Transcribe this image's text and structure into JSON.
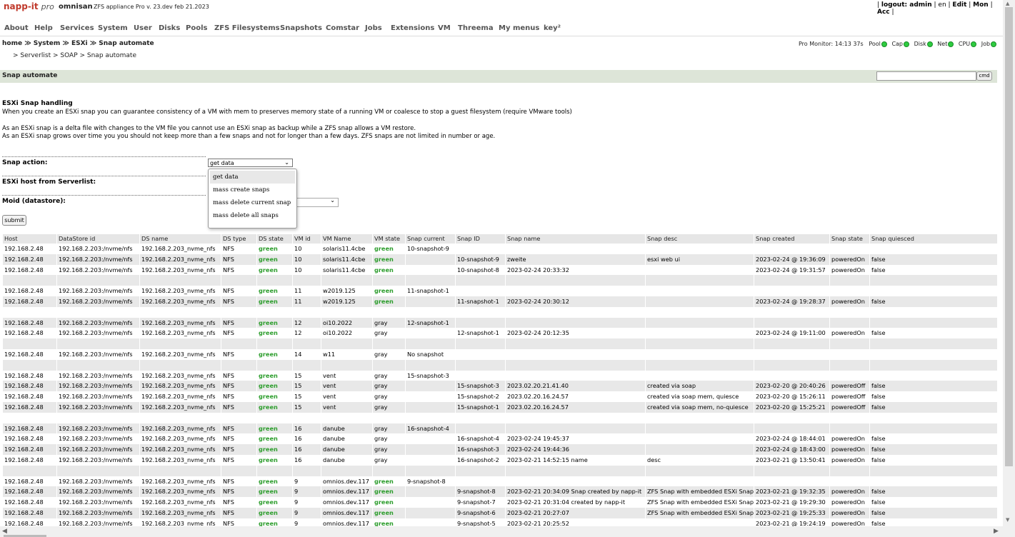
{
  "header": {
    "logo": "napp-it",
    "logo_pro": "pro",
    "hostname": "omnisan",
    "version": "ZFS appliance Pro v. 23.dev feb 21.2023",
    "logout": "logout: admin",
    "lang": "en",
    "edit": "Edit",
    "mon": "Mon",
    "acc": "Acc"
  },
  "nav": {
    "items": [
      "About",
      "Help",
      "Services",
      "System",
      "User",
      "Disks",
      "Pools",
      "ZFS Filesystems",
      "Snapshots",
      "Comstar",
      "Jobs",
      "Extensions",
      "VM",
      "Threema",
      "My menus",
      "key²"
    ]
  },
  "breadcrumb": {
    "line1": "home ≫ System ≫ ESXi ≫ Snap automate",
    "line2": "> Serverlist  > SOAP  > Snap automate"
  },
  "monitor": {
    "label": "Pro Monitor: 14:13 37s",
    "items": [
      "Pool",
      "Cap",
      "Disk",
      "Net",
      "CPU",
      "Job"
    ]
  },
  "section": {
    "title": "Snap automate",
    "cmd_label": "cmd"
  },
  "info": {
    "heading": "ESXi Snap handling",
    "p1": "When you create an ESXi snap you can guarantee consistency of a VM with mem to preserves memory state of a running VM or coalesce to stop a guest filesystem (require VMware tools)",
    "p2": "As an ESXi snap is a delta file with changes to the VM file you cannot use an ESXi snap as backup while a ZFS snap allows a VM restore.",
    "p3": "As an ESXi snap grows over time you you should not keep more than a few snaps and not for longer than a few days. ZFS snaps are not limited in number or age."
  },
  "form": {
    "snap_action_label": "Snap action:",
    "snap_action_value": "get data",
    "esxi_host_label": "ESXi host from Serverlist:",
    "moid_label": "Moid (datastore):",
    "submit_label": "submit",
    "dropdown_options": [
      "get data",
      "mass create snaps",
      "mass delete current snap",
      "mass delete all snaps"
    ]
  },
  "table": {
    "columns": [
      "Host",
      "DataStore id",
      "DS name",
      "DS type",
      "DS state",
      "VM id",
      "VM Name",
      "VM state",
      "Snap current",
      "Snap ID",
      "Snap name",
      "Snap desc",
      "Snap created",
      "Snap state",
      "Snap quiesced"
    ],
    "rows": [
      [
        "192.168.2.48",
        "192.168.2.203:/nvme/nfs",
        "192.168.2.203_nvme_nfs",
        "NFS",
        "green",
        "10",
        "solaris11.4cbe",
        "green",
        "10-snapshot-9",
        "",
        "",
        "",
        "",
        "",
        ""
      ],
      [
        "192.168.2.48",
        "192.168.2.203:/nvme/nfs",
        "192.168.2.203_nvme_nfs",
        "NFS",
        "green",
        "10",
        "solaris11.4cbe",
        "green",
        "",
        "10-snapshot-9",
        "zweite",
        "esxi web ui",
        "2023-02-24 @ 19:36:09",
        "poweredOn",
        "false"
      ],
      [
        "192.168.2.48",
        "192.168.2.203:/nvme/nfs",
        "192.168.2.203_nvme_nfs",
        "NFS",
        "green",
        "10",
        "solaris11.4cbe",
        "green",
        "",
        "10-snapshot-8",
        "2023-02-24 20:33:32",
        "",
        "2023-02-24 @ 19:31:57",
        "poweredOn",
        "false"
      ],
      [
        "",
        "",
        "",
        "",
        "",
        "",
        "",
        "",
        "",
        "",
        "",
        "",
        "",
        "",
        ""
      ],
      [
        "192.168.2.48",
        "192.168.2.203:/nvme/nfs",
        "192.168.2.203_nvme_nfs",
        "NFS",
        "green",
        "11",
        "w2019.125",
        "green",
        "11-snapshot-1",
        "",
        "",
        "",
        "",
        "",
        ""
      ],
      [
        "192.168.2.48",
        "192.168.2.203:/nvme/nfs",
        "192.168.2.203_nvme_nfs",
        "NFS",
        "green",
        "11",
        "w2019.125",
        "green",
        "",
        "11-snapshot-1",
        "2023-02-24 20:30:12",
        "",
        "2023-02-24 @ 19:28:37",
        "poweredOn",
        "false"
      ],
      [
        "",
        "",
        "",
        "",
        "",
        "",
        "",
        "",
        "",
        "",
        "",
        "",
        "",
        "",
        ""
      ],
      [
        "192.168.2.48",
        "192.168.2.203:/nvme/nfs",
        "192.168.2.203_nvme_nfs",
        "NFS",
        "green",
        "12",
        "oi10.2022",
        "gray",
        "12-snapshot-1",
        "",
        "",
        "",
        "",
        "",
        ""
      ],
      [
        "192.168.2.48",
        "192.168.2.203:/nvme/nfs",
        "192.168.2.203_nvme_nfs",
        "NFS",
        "green",
        "12",
        "oi10.2022",
        "gray",
        "",
        "12-snapshot-1",
        "2023-02-24 20:12:35",
        "",
        "2023-02-24 @ 19:11:00",
        "poweredOn",
        "false"
      ],
      [
        "",
        "",
        "",
        "",
        "",
        "",
        "",
        "",
        "",
        "",
        "",
        "",
        "",
        "",
        ""
      ],
      [
        "192.168.2.48",
        "192.168.2.203:/nvme/nfs",
        "192.168.2.203_nvme_nfs",
        "NFS",
        "green",
        "14",
        "w11",
        "gray",
        "No snapshot",
        "",
        "",
        "",
        "",
        "",
        ""
      ],
      [
        "",
        "",
        "",
        "",
        "",
        "",
        "",
        "",
        "",
        "",
        "",
        "",
        "",
        "",
        ""
      ],
      [
        "192.168.2.48",
        "192.168.2.203:/nvme/nfs",
        "192.168.2.203_nvme_nfs",
        "NFS",
        "green",
        "15",
        "vent",
        "gray",
        "15-snapshot-3",
        "",
        "",
        "",
        "",
        "",
        ""
      ],
      [
        "192.168.2.48",
        "192.168.2.203:/nvme/nfs",
        "192.168.2.203_nvme_nfs",
        "NFS",
        "green",
        "15",
        "vent",
        "gray",
        "",
        "15-snapshot-3",
        "2023.02.20.21.41.40",
        "created via soap",
        "2023-02-20 @ 20:40:26",
        "poweredOff",
        "false"
      ],
      [
        "192.168.2.48",
        "192.168.2.203:/nvme/nfs",
        "192.168.2.203_nvme_nfs",
        "NFS",
        "green",
        "15",
        "vent",
        "gray",
        "",
        "15-snapshot-2",
        "2023.02.20.16.24.57",
        "created via soap mem, quiesce",
        "2023-02-20 @ 15:26:11",
        "poweredOff",
        "false"
      ],
      [
        "192.168.2.48",
        "192.168.2.203:/nvme/nfs",
        "192.168.2.203_nvme_nfs",
        "NFS",
        "green",
        "15",
        "vent",
        "gray",
        "",
        "15-snapshot-1",
        "2023.02.20.16.24.57",
        "created via soap mem, no-quiesce",
        "2023-02-20 @ 15:25:21",
        "poweredOff",
        "false"
      ],
      [
        "",
        "",
        "",
        "",
        "",
        "",
        "",
        "",
        "",
        "",
        "",
        "",
        "",
        "",
        ""
      ],
      [
        "192.168.2.48",
        "192.168.2.203:/nvme/nfs",
        "192.168.2.203_nvme_nfs",
        "NFS",
        "green",
        "16",
        "danube",
        "gray",
        "16-snapshot-4",
        "",
        "",
        "",
        "",
        "",
        ""
      ],
      [
        "192.168.2.48",
        "192.168.2.203:/nvme/nfs",
        "192.168.2.203_nvme_nfs",
        "NFS",
        "green",
        "16",
        "danube",
        "gray",
        "",
        "16-snapshot-4",
        "2023-02-24 19:45:37",
        "",
        "2023-02-24 @ 18:44:01",
        "poweredOn",
        "false"
      ],
      [
        "192.168.2.48",
        "192.168.2.203:/nvme/nfs",
        "192.168.2.203_nvme_nfs",
        "NFS",
        "green",
        "16",
        "danube",
        "gray",
        "",
        "16-snapshot-3",
        "2023-02-24 19:44:36",
        "",
        "2023-02-24 @ 18:43:00",
        "poweredOn",
        "false"
      ],
      [
        "192.168.2.48",
        "192.168.2.203:/nvme/nfs",
        "192.168.2.203_nvme_nfs",
        "NFS",
        "green",
        "16",
        "danube",
        "gray",
        "",
        "16-snapshot-2",
        "2023-02-21 14:52:15 name",
        "desc",
        "2023-02-21 @ 13:50:41",
        "poweredOn",
        "false"
      ],
      [
        "",
        "",
        "",
        "",
        "",
        "",
        "",
        "",
        "",
        "",
        "",
        "",
        "",
        "",
        ""
      ],
      [
        "192.168.2.48",
        "192.168.2.203:/nvme/nfs",
        "192.168.2.203_nvme_nfs",
        "NFS",
        "green",
        "9",
        "omnios.dev.117",
        "green",
        "9-snapshot-8",
        "",
        "",
        "",
        "",
        "",
        ""
      ],
      [
        "192.168.2.48",
        "192.168.2.203:/nvme/nfs",
        "192.168.2.203_nvme_nfs",
        "NFS",
        "green",
        "9",
        "omnios.dev.117",
        "green",
        "",
        "9-snapshot-8",
        "2023-02-21 20:34:09 Snap created by napp-it",
        "ZFS Snap with embedded ESXi Snap",
        "2023-02-21 @ 19:32:35",
        "poweredOn",
        "false"
      ],
      [
        "192.168.2.48",
        "192.168.2.203:/nvme/nfs",
        "192.168.2.203_nvme_nfs",
        "NFS",
        "green",
        "9",
        "omnios.dev.117",
        "green",
        "",
        "9-snapshot-7",
        "2023-02-21 20:31:04 created by napp-it",
        "ZFS Snap with embedded ESXi Snap",
        "2023-02-21 @ 19:29:30",
        "poweredOn",
        "false"
      ],
      [
        "192.168.2.48",
        "192.168.2.203:/nvme/nfs",
        "192.168.2.203_nvme_nfs",
        "NFS",
        "green",
        "9",
        "omnios.dev.117",
        "green",
        "",
        "9-snapshot-6",
        "2023-02-21 20:27:07",
        "ZFS Snap with embedded ESXi Snap",
        "2023-02-21 @ 19:25:33",
        "poweredOn",
        "false"
      ],
      [
        "192.168.2.48",
        "192.168.2.203:/nvme/nfs",
        "192.168.2.203_nvme_nfs",
        "NFS",
        "green",
        "9",
        "omnios.dev.117",
        "green",
        "",
        "9-snapshot-5",
        "2023-02-21 20:25:52",
        "",
        "2023-02-21 @ 19:24:19",
        "poweredOn",
        "false"
      ]
    ]
  },
  "colors": {
    "logo": "#c0392b",
    "status_green": "#2e9e2e",
    "section_bar": "#dde5d8",
    "row_alt": "#e8e8e8"
  }
}
